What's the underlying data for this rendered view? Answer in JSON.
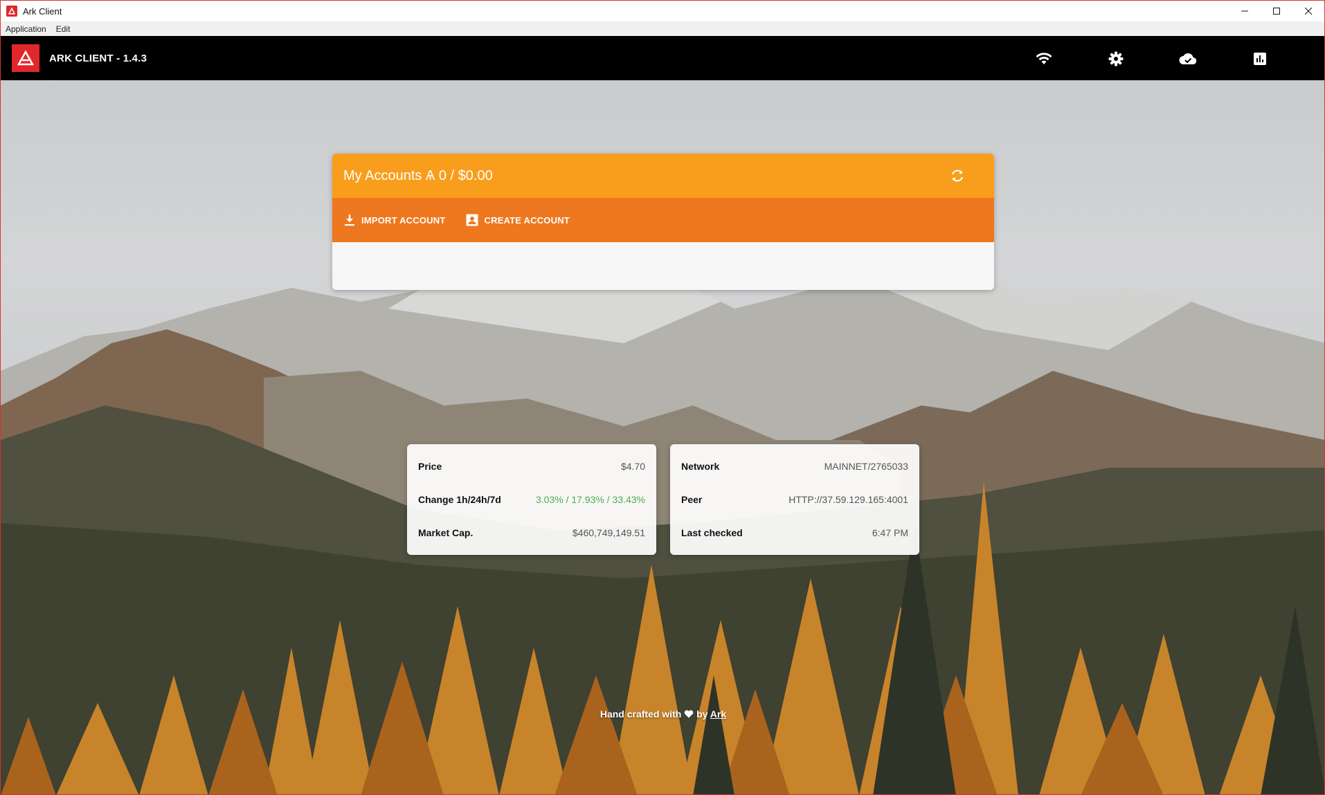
{
  "window": {
    "title": "Ark Client",
    "controls": [
      "minimize-icon",
      "maximize-icon",
      "close-icon"
    ]
  },
  "menu": {
    "items": [
      "Application",
      "Edit"
    ]
  },
  "header": {
    "app_name": "ARK CLIENT - 1.4.3",
    "icons": [
      "wifi-icon",
      "gear-icon",
      "cloud-icon",
      "chart-icon",
      "power-icon"
    ]
  },
  "accounts": {
    "title": "My Accounts Ѧ 0 / $0.00",
    "import_label": "IMPORT ACCOUNT",
    "create_label": "CREATE ACCOUNT"
  },
  "market": {
    "rows": [
      {
        "label": "Price",
        "value": "$4.70"
      },
      {
        "label": "Change 1h/24h/7d",
        "value": "3.03% / 17.93% / 33.43%"
      },
      {
        "label": "Market Cap.",
        "value": "$460,749,149.51"
      }
    ]
  },
  "network": {
    "rows": [
      {
        "label": "Network",
        "value": "MAINNET/2765033"
      },
      {
        "label": "Peer",
        "value": "HTTP://37.59.129.165:4001"
      },
      {
        "label": "Last checked",
        "value": "6:47 PM"
      }
    ]
  },
  "footer": {
    "text_before": "Hand crafted with",
    "text_by": "by",
    "link": "Ark"
  },
  "colors": {
    "accent_orange": "#f99e1c",
    "accent_dark_orange": "#ee781f",
    "brand_red": "#e0282b",
    "positive_green": "#4cae50"
  }
}
